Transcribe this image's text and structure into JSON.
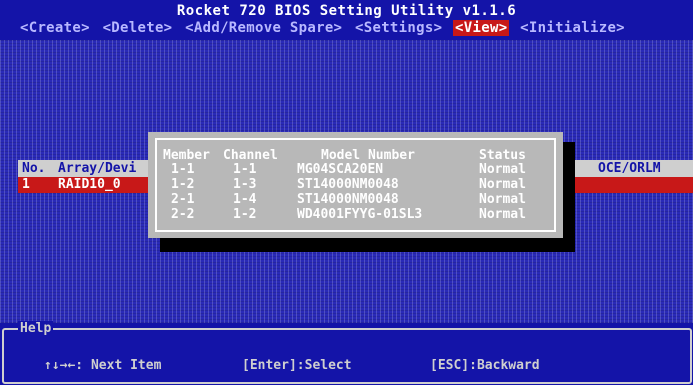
{
  "title": "Rocket 720 BIOS Setting Utility v1.1.6",
  "menu": [
    {
      "label": "<Create>"
    },
    {
      "label": "<Delete>"
    },
    {
      "label": "<Add/Remove Spare>"
    },
    {
      "label": "<Settings>"
    },
    {
      "label": "<View>",
      "active": true
    },
    {
      "label": "<Initialize>"
    }
  ],
  "array_table": {
    "headers": {
      "no": "No.",
      "array": "Array/Devi",
      "oce": "OCE/ORLM"
    },
    "rows": [
      {
        "no": "1",
        "name": "RAID10_0"
      }
    ]
  },
  "popup": {
    "headers": {
      "member": "Member",
      "channel": "Channel",
      "model": "Model Number",
      "status": "Status"
    },
    "rows": [
      {
        "member": "1-1",
        "channel": "1-1",
        "model": "MG04SCA20EN",
        "status": "Normal"
      },
      {
        "member": "1-2",
        "channel": "1-3",
        "model": "ST14000NM0048",
        "status": "Normal"
      },
      {
        "member": "2-1",
        "channel": "1-4",
        "model": "ST14000NM0048",
        "status": "Normal"
      },
      {
        "member": "2-2",
        "channel": "1-2",
        "model": "WD4001FYYG-01SL3",
        "status": "Normal"
      }
    ]
  },
  "help": {
    "label": "Help",
    "items": [
      {
        "text": "↑↓→←: Next Item"
      },
      {
        "text": "[Enter]:Select"
      },
      {
        "text": "[ESC]:Backward"
      }
    ]
  }
}
